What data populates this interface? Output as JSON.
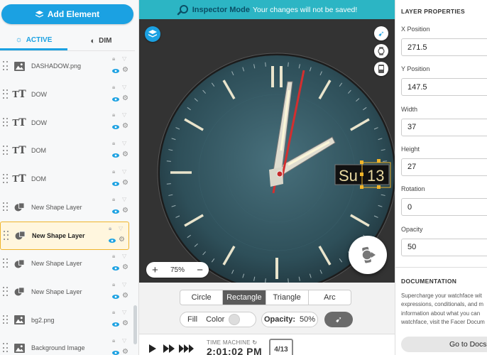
{
  "left_panel": {
    "add_element_label": "Add Element",
    "tabs": [
      {
        "label": "ACTIVE",
        "active": true
      },
      {
        "label": "DIM",
        "active": false
      }
    ],
    "layers": [
      {
        "name": "DASHADOW.png",
        "type": "image"
      },
      {
        "name": "DOW",
        "type": "text"
      },
      {
        "name": "DOW",
        "type": "text"
      },
      {
        "name": "DOM",
        "type": "text"
      },
      {
        "name": "DOM",
        "type": "text"
      },
      {
        "name": "New Shape Layer",
        "type": "shape"
      },
      {
        "name": "New Shape Layer",
        "type": "shape",
        "selected": true
      },
      {
        "name": "New Shape Layer",
        "type": "shape"
      },
      {
        "name": "New Shape Layer",
        "type": "shape"
      },
      {
        "name": "bg2.png",
        "type": "image"
      },
      {
        "name": "Background Image",
        "type": "image"
      }
    ]
  },
  "inspector": {
    "title": "Inspector Mode",
    "message": "Your changes will not be saved!"
  },
  "canvas": {
    "day_label": "Su",
    "date_label": "13",
    "zoom_label": "75%",
    "zoom_in": "+",
    "zoom_out": "−"
  },
  "shape_types": [
    {
      "label": "Circle",
      "active": false
    },
    {
      "label": "Rectangle",
      "active": true
    },
    {
      "label": "Triangle",
      "active": false
    },
    {
      "label": "Arc",
      "active": false
    }
  ],
  "style_controls": {
    "fill_label": "Fill",
    "color_label": "Color",
    "opacity_label": "Opacity:",
    "opacity_value": "50%"
  },
  "time_machine": {
    "label": "TIME MACHINE",
    "time": "2:01:02 PM",
    "date": "4/13"
  },
  "properties": {
    "title": "LAYER PROPERTIES",
    "fields": [
      {
        "label": "X Position",
        "value": "271.5"
      },
      {
        "label": "Y Position",
        "value": "147.5"
      },
      {
        "label": "Width",
        "value": "37"
      },
      {
        "label": "Height",
        "value": "27"
      },
      {
        "label": "Rotation",
        "value": "0"
      },
      {
        "label": "Opacity",
        "value": "50"
      }
    ]
  },
  "documentation": {
    "title": "DOCUMENTATION",
    "lines": [
      "Supercharge your watchface wit",
      "expressions, conditionals, and m",
      "information about what you can",
      "watchface, visit the Facer Docum"
    ],
    "button_label": "Go to Docs"
  },
  "colors": {
    "accent": "#1ba1e2",
    "inspector_bar": "#2cb5c4",
    "selected_layer": "#fff6de",
    "selection_border": "#f0b429",
    "second_hand": "#d32f2f"
  }
}
